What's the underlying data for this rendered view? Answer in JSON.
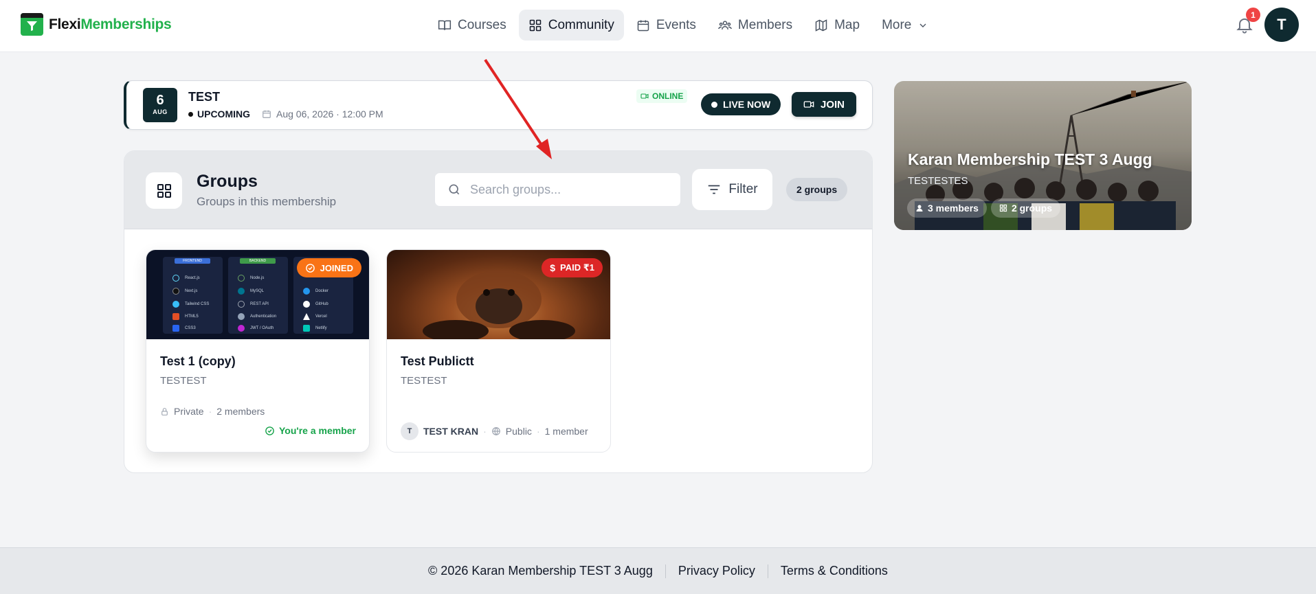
{
  "brand": {
    "part1": "Flexi",
    "part2": "Memberships"
  },
  "nav": {
    "items": [
      {
        "label": "Courses",
        "icon": "book-open-icon"
      },
      {
        "label": "Community",
        "icon": "grid-icon",
        "active": true
      },
      {
        "label": "Events",
        "icon": "calendar-icon"
      },
      {
        "label": "Members",
        "icon": "users-icon"
      },
      {
        "label": "Map",
        "icon": "map-icon"
      },
      {
        "label": "More",
        "icon": "chevron-down-icon"
      }
    ]
  },
  "notifications": {
    "count": "1"
  },
  "user": {
    "initial": "T"
  },
  "event": {
    "day": "6",
    "month": "AUG",
    "title": "TEST",
    "status": "UPCOMING",
    "datetime": "Aug 06, 2026 · 12:00 PM",
    "online_label": "ONLINE",
    "live_label": "LIVE NOW",
    "join_label": "JOIN"
  },
  "groups": {
    "title": "Groups",
    "subtitle": "Groups in this membership",
    "search_placeholder": "Search groups...",
    "filter_label": "Filter",
    "count_label": "2 groups",
    "cards": [
      {
        "name": "Test 1 (copy)",
        "description": "TESTEST",
        "badge": "JOINED",
        "privacy": "Private",
        "members": "2 members",
        "member_status": "You're a member",
        "tech": {
          "frontend_label": "FRONTEND",
          "backend_label": "BACKEND",
          "frontend": [
            "React.js",
            "Next.js",
            "Tailwind CSS",
            "HTML5",
            "CSS3"
          ],
          "backend": [
            "Node.js",
            "MySQL",
            "REST API",
            "Authentication",
            "JWT / OAuth"
          ],
          "devops": [
            "Docker",
            "GitHub",
            "Vercel",
            "Netlify"
          ]
        }
      },
      {
        "name": "Test Publictt",
        "description": "TESTEST",
        "badge": "PAID ₹1",
        "owner_initial": "T",
        "owner": "TEST KRAN",
        "privacy": "Public",
        "members": "1 member"
      }
    ]
  },
  "membership": {
    "title": "Karan Membership TEST 3 Augg",
    "subtitle": "TESTESTES",
    "members_chip": "3 members",
    "groups_chip": "2 groups"
  },
  "footer": {
    "copyright": "© 2026 Karan Membership TEST 3 Augg",
    "privacy": "Privacy Policy",
    "terms": "Terms & Conditions"
  },
  "colors": {
    "brand_green": "#22b14c",
    "dark_teal": "#0f2a30",
    "joined_orange": "#f97316",
    "paid_red": "#dc2626",
    "success_green": "#16a34a",
    "annotation_arrow": "#e02424"
  }
}
